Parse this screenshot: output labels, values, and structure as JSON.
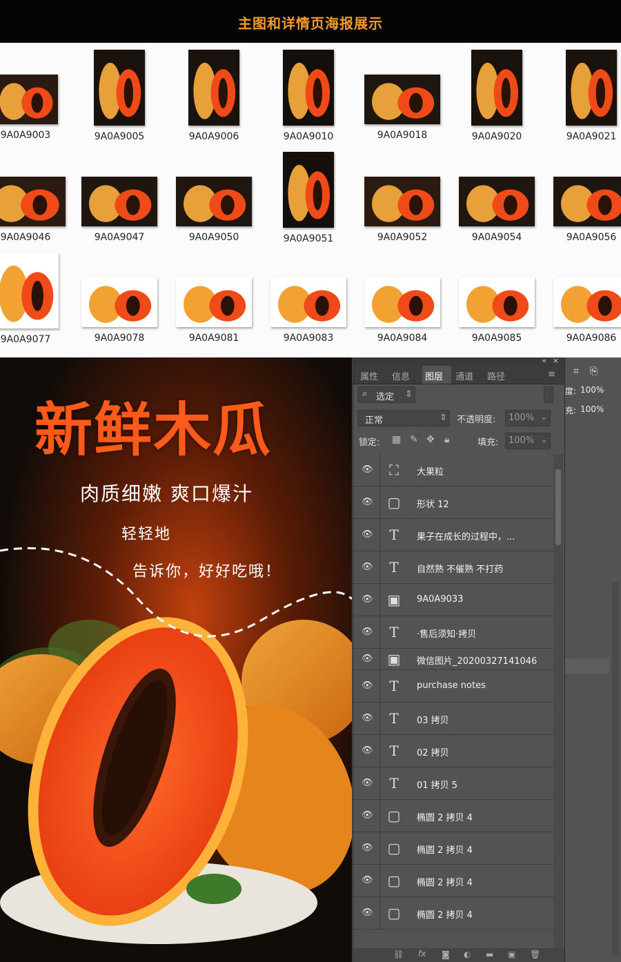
{
  "header": {
    "title": "主图和详情页海报展示"
  },
  "thumbnails": [
    {
      "name": "9A0A9003"
    },
    {
      "name": "9A0A9005"
    },
    {
      "name": "9A0A9006"
    },
    {
      "name": "9A0A9010"
    },
    {
      "name": "9A0A9018"
    },
    {
      "name": "9A0A9020"
    },
    {
      "name": "9A0A9021"
    },
    {
      "name": "9A0A9046"
    },
    {
      "name": "9A0A9047"
    },
    {
      "name": "9A0A9050"
    },
    {
      "name": "9A0A9051"
    },
    {
      "name": "9A0A9052"
    },
    {
      "name": "9A0A9054"
    },
    {
      "name": "9A0A9056"
    },
    {
      "name": "9A0A9077"
    },
    {
      "name": "9A0A9078"
    },
    {
      "name": "9A0A9081"
    },
    {
      "name": "9A0A9083"
    },
    {
      "name": "9A0A9084"
    },
    {
      "name": "9A0A9085"
    },
    {
      "name": "9A0A9086"
    }
  ],
  "poster": {
    "title": "新鲜木瓜",
    "subtitle": "肉质细嫩 爽口爆汁",
    "line1": "轻轻地",
    "line2": "告诉你，好好吃哦！"
  },
  "panel": {
    "tabs": [
      "属性",
      "信息",
      "图层",
      "通道",
      "路径"
    ],
    "active_tab": "图层",
    "filter_label": "选定",
    "blend_mode": "正常",
    "opacity_label": "不透明度:",
    "opacity_value": "100%",
    "lock_label": "锁定:",
    "fill_label": "填充:",
    "fill_value": "100%",
    "layers": [
      {
        "name": "大果粒",
        "icon": "puppet-icon"
      },
      {
        "name": "形状 12",
        "icon": "shape-layer-icon"
      },
      {
        "name": "果子在成长的过程中，...",
        "icon": "text-layer-icon"
      },
      {
        "name": "自然熟 不催熟 不打药",
        "icon": "text-layer-icon"
      },
      {
        "name": "9A0A9033",
        "icon": "smart-object-icon"
      },
      {
        "name": "·售后须知·拷贝",
        "icon": "text-layer-icon"
      },
      {
        "name": "微信图片_20200327141046",
        "icon": "smart-object-icon"
      },
      {
        "name": "purchase notes",
        "icon": "text-layer-icon"
      },
      {
        "name": "03 拷贝",
        "icon": "text-layer-icon"
      },
      {
        "name": "02 拷贝",
        "icon": "text-layer-icon"
      },
      {
        "name": "01 拷贝 5",
        "icon": "text-layer-icon"
      },
      {
        "name": "椭圆 2 拷贝 4",
        "icon": "shape-layer-icon"
      },
      {
        "name": "椭圆 2 拷贝 4",
        "icon": "shape-layer-icon"
      },
      {
        "name": "椭圆 2 拷贝 4",
        "icon": "shape-layer-icon"
      },
      {
        "name": "椭圆 2 拷贝 4",
        "icon": "shape-layer-icon"
      }
    ]
  },
  "right_strip": {
    "opacity_label": "度:",
    "opacity_value": "100%",
    "fill_label": "充:",
    "fill_value": "100%"
  },
  "colors": {
    "accent": "#f39a2e",
    "papaya": "#ff5a1a",
    "panel_bg": "#535353"
  }
}
